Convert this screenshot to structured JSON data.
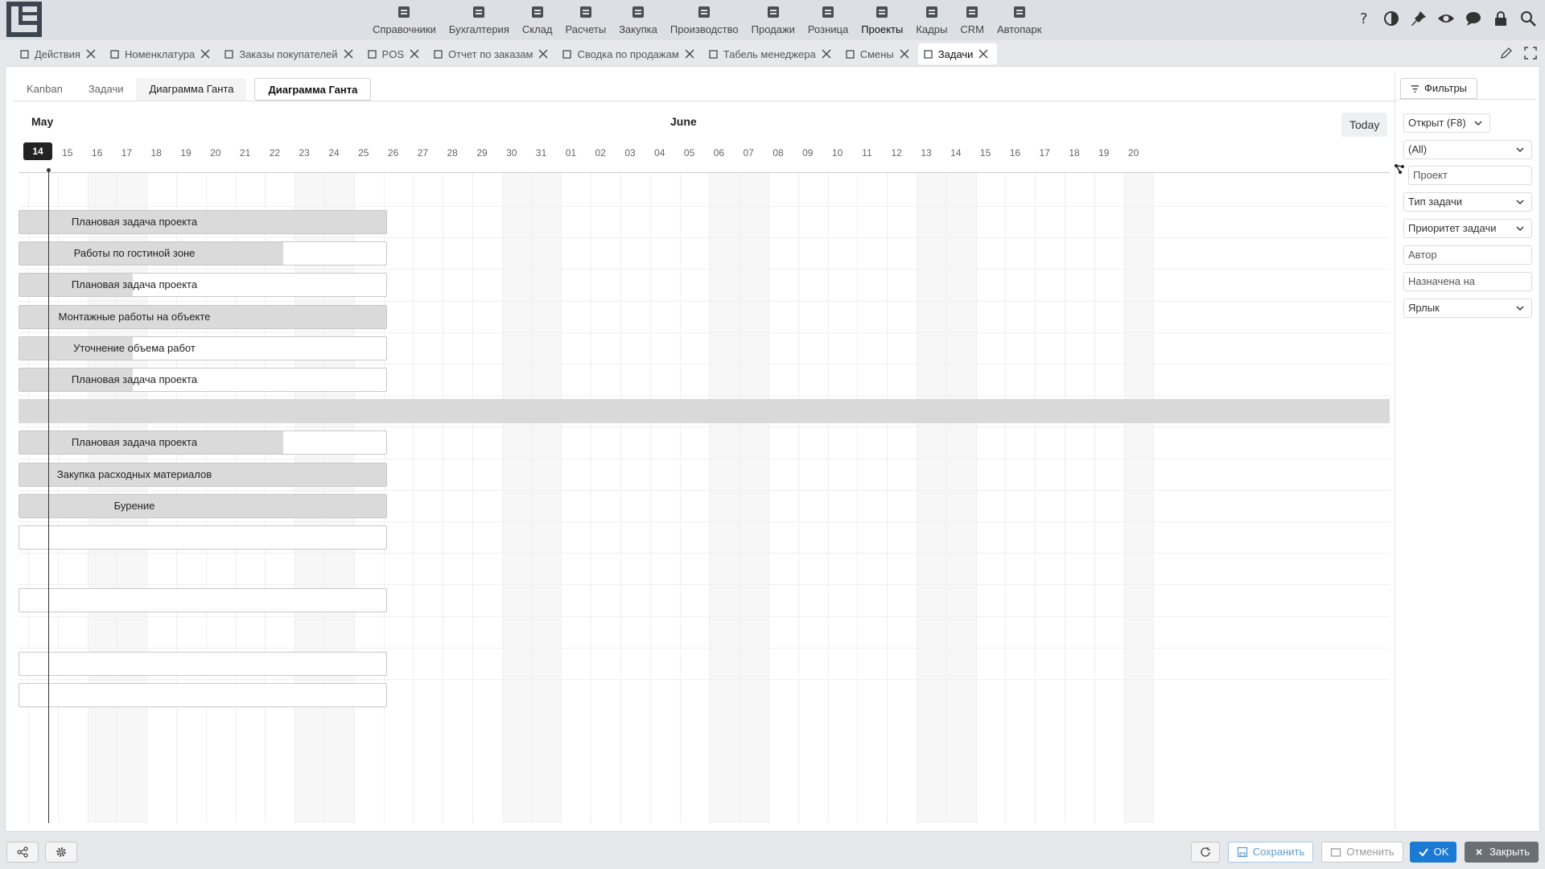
{
  "topnav": [
    {
      "label": "Справочники",
      "icon": "list-icon"
    },
    {
      "label": "Бухгалтерия",
      "icon": "ledger-icon"
    },
    {
      "label": "Склад",
      "icon": "warehouse-icon"
    },
    {
      "label": "Расчеты",
      "icon": "cash-icon"
    },
    {
      "label": "Закупка",
      "icon": "cart-icon"
    },
    {
      "label": "Производство",
      "icon": "factory-icon"
    },
    {
      "label": "Продажи",
      "icon": "hand-coin-icon"
    },
    {
      "label": "Розница",
      "icon": "bag-icon"
    },
    {
      "label": "Проекты",
      "icon": "project-icon"
    },
    {
      "label": "Кадры",
      "icon": "fingerprint-icon"
    },
    {
      "label": "CRM",
      "icon": "contact-card-icon"
    },
    {
      "label": "Автопарк",
      "icon": "bus-icon"
    }
  ],
  "active_nav": "Проекты",
  "doctabs": [
    {
      "label": "Действия"
    },
    {
      "label": "Номенклатура"
    },
    {
      "label": "Заказы покупателей"
    },
    {
      "label": "POS"
    },
    {
      "label": "Отчет по заказам"
    },
    {
      "label": "Сводка по продажам"
    },
    {
      "label": "Табель менеджера"
    },
    {
      "label": "Смены"
    },
    {
      "label": "Задачи"
    }
  ],
  "active_doctab": "Задачи",
  "subtabs": {
    "kanban": "Kanban",
    "tasks": "Задачи",
    "gantt": "Диаграмма Ганта",
    "gantt_active": "Диаграмма Ганта"
  },
  "gantt": {
    "month_may": "May",
    "month_june": "June",
    "today_label": "Today",
    "today_day": "14",
    "days": [
      "14",
      "15",
      "16",
      "17",
      "18",
      "19",
      "20",
      "21",
      "22",
      "23",
      "24",
      "25",
      "26",
      "27",
      "28",
      "29",
      "30",
      "31",
      "01",
      "02",
      "03",
      "04",
      "05",
      "06",
      "07",
      "08",
      "09",
      "10",
      "11",
      "12",
      "13",
      "14",
      "15",
      "16",
      "17",
      "18",
      "19",
      "20"
    ],
    "rows": [
      {
        "type": "bar",
        "label": "Плановая задача проекта",
        "progress": 1.0
      },
      {
        "type": "bar",
        "label": "Работы по гостиной зоне",
        "progress": 0.72
      },
      {
        "type": "bar",
        "label": "Плановая задача проекта",
        "progress": 0.31
      },
      {
        "type": "bar",
        "label": "Монтажные работы на объекте",
        "progress": 1.0
      },
      {
        "type": "bar",
        "label": "Уточнение объема работ",
        "progress": 0.31
      },
      {
        "type": "bar",
        "label": "Плановая задача проекта",
        "progress": 0.31
      },
      {
        "type": "group",
        "label": ""
      },
      {
        "type": "bar",
        "label": "Плановая задача проекта",
        "progress": 0.72
      },
      {
        "type": "bar",
        "label": "Закупка расходных материалов",
        "progress": 1.0
      },
      {
        "type": "bar",
        "label": "Бурение",
        "progress": 1.0
      },
      {
        "type": "bar",
        "label": "",
        "progress": 0
      },
      {
        "type": "empty",
        "label": ""
      },
      {
        "type": "bar",
        "label": "",
        "progress": 0
      },
      {
        "type": "empty",
        "label": ""
      },
      {
        "type": "bar",
        "label": "",
        "progress": 0
      },
      {
        "type": "bar",
        "label": "",
        "progress": 0
      }
    ]
  },
  "filters": {
    "tab_label": "Фильтры",
    "status": "Открыт (F8)",
    "all": "(All)",
    "project": "Проект",
    "task_type": "Тип задачи",
    "priority": "Приоритет задачи",
    "author": "Автор",
    "assigned": "Назначена на",
    "label": "Ярлык"
  },
  "bottom": {
    "save": "Сохранить",
    "cancel": "Отменить",
    "ok": "OK",
    "close": "Закрыть"
  },
  "colors": {
    "ok_button": "#1a7ad4",
    "close_button": "#6a6f75",
    "save_text": "#5b9bd5",
    "bar_fill": "#dadada",
    "today_marker": "#222222"
  }
}
